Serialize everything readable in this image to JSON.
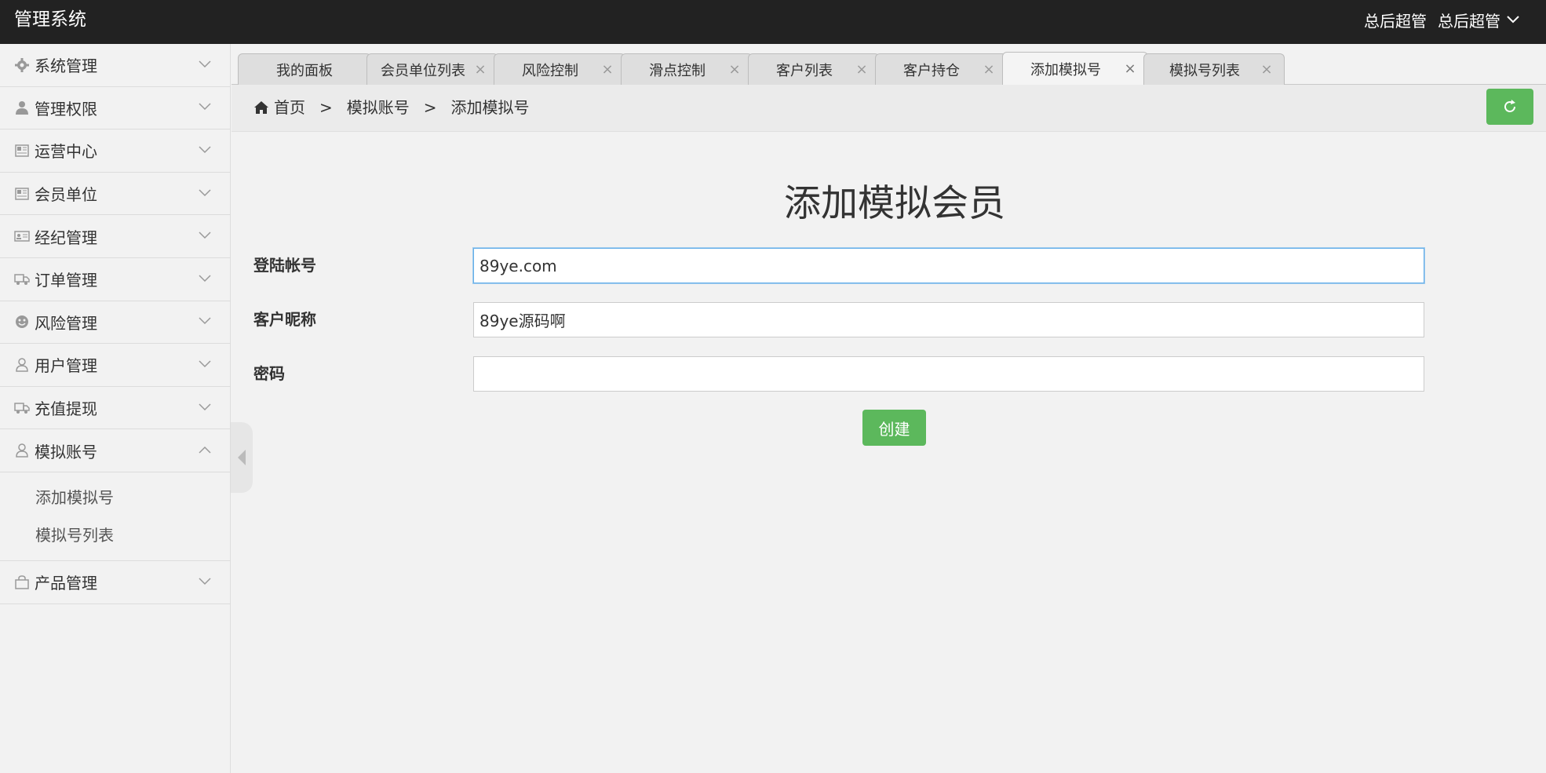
{
  "app": {
    "title": "管理系统",
    "role": "总后超管",
    "user": "总后超管"
  },
  "sidebar": {
    "items": [
      {
        "label": "系统管理",
        "icon": "gear-icon"
      },
      {
        "label": "管理权限",
        "icon": "user-icon"
      },
      {
        "label": "运营中心",
        "icon": "newspaper-icon"
      },
      {
        "label": "会员单位",
        "icon": "newspaper-icon"
      },
      {
        "label": "经纪管理",
        "icon": "id-card-icon"
      },
      {
        "label": "订单管理",
        "icon": "truck-icon"
      },
      {
        "label": "风险管理",
        "icon": "smile-icon"
      },
      {
        "label": "用户管理",
        "icon": "user-outline-icon"
      },
      {
        "label": "充值提现",
        "icon": "truck-icon"
      },
      {
        "label": "模拟账号",
        "icon": "user-outline-icon",
        "expanded": true
      },
      {
        "label": "产品管理",
        "icon": "bag-icon"
      }
    ],
    "sub_items": [
      "添加模拟号",
      "模拟号列表"
    ]
  },
  "tabs": [
    {
      "label": "我的面板",
      "closable": false
    },
    {
      "label": "会员单位列表",
      "closable": true
    },
    {
      "label": "风险控制",
      "closable": true
    },
    {
      "label": "滑点控制",
      "closable": true
    },
    {
      "label": "客户列表",
      "closable": true
    },
    {
      "label": "客户持仓",
      "closable": true
    },
    {
      "label": "添加模拟号",
      "closable": true,
      "active": true
    },
    {
      "label": "模拟号列表",
      "closable": true
    }
  ],
  "breadcrumb": [
    "首页",
    "模拟账号",
    "添加模拟号"
  ],
  "breadcrumb_sep": ">",
  "form": {
    "title": "添加模拟会员",
    "fields": [
      {
        "label": "登陆帐号",
        "value": "89ye.com"
      },
      {
        "label": "客户昵称",
        "value": "89ye源码啊"
      },
      {
        "label": "密码",
        "value": ""
      }
    ],
    "submit_label": "创建"
  },
  "colors": {
    "topbar": "#222222",
    "accent_green": "#5cb85c",
    "focus_blue": "#66afe9"
  }
}
